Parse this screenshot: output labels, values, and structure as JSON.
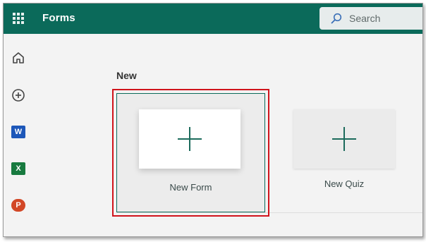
{
  "header": {
    "app_title": "Forms",
    "search_placeholder": "Search",
    "bar_color": "#0b6a5a"
  },
  "rail": {
    "items": [
      {
        "name": "home-icon"
      },
      {
        "name": "add-circle-icon"
      },
      {
        "name": "word-icon",
        "letter": "W",
        "color": "#1d57b9"
      },
      {
        "name": "excel-icon",
        "letter": "X",
        "color": "#177a3f"
      },
      {
        "name": "powerpoint-icon",
        "letter": "P",
        "color": "#d24726"
      }
    ]
  },
  "main": {
    "section_title": "New",
    "tiles": [
      {
        "label": "New Form",
        "icon": "plus-icon"
      },
      {
        "label": "New Quiz",
        "icon": "plus-icon"
      }
    ]
  },
  "annotation": {
    "highlight_color": "#d0141c"
  }
}
